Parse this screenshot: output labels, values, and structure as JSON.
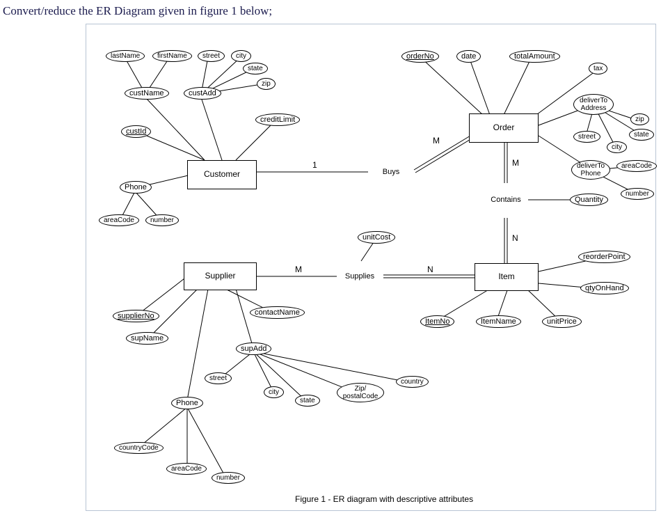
{
  "title": "Convert/reduce the ER Diagram given in figure 1 below;",
  "caption": "Figure 1 - ER diagram with descriptive attributes",
  "entities": {
    "customer": "Customer",
    "order": "Order",
    "supplier": "Supplier",
    "item": "Item"
  },
  "relationships": {
    "buys": "Buys",
    "contains": "Contains",
    "supplies": "Supplies"
  },
  "rel_attrs": {
    "quantity": "Quantity",
    "unitCost": "unitCost"
  },
  "cardinalities": {
    "buys_cust": "1",
    "buys_order": "M",
    "contains_order": "M",
    "contains_item": "N",
    "supplies_supplier": "M",
    "supplies_item": "N"
  },
  "customer_attrs": {
    "custId": "custId",
    "custName": "custName",
    "lastName": "lastName",
    "firstName": "firstName",
    "custAdd": "custAdd",
    "street": "street",
    "city": "city",
    "state": "state",
    "zip": "zip",
    "creditLimit": "creditLimit",
    "phone": "Phone",
    "areaCode": "areaCode",
    "number": "number"
  },
  "order_attrs": {
    "orderNo": "orderNo",
    "date": "date",
    "totalAmount": "totalAmount",
    "tax": "tax",
    "deliverToAddress": "deliverTo\nAddress",
    "da_zip": "zip",
    "da_state": "state",
    "da_street": "street",
    "da_city": "city",
    "deliverToPhone": "deliverTo\nPhone",
    "dp_areaCode": "areaCode",
    "dp_number": "number"
  },
  "item_attrs": {
    "itemNo": "ItemNo",
    "itemName": "ItemName",
    "unitPrice": "unitPrice",
    "qtyOnHand": "qtyOnHand",
    "reorderPoint": "reorderPoint"
  },
  "supplier_attrs": {
    "supplierNo": "supplierNo",
    "supName": "supName",
    "contactName": "contactName",
    "supAdd": "supAdd",
    "sa_street": "street",
    "sa_city": "city",
    "sa_state": "state",
    "sa_zip": "Zip/\npostalCode",
    "sa_country": "country",
    "phone": "Phone",
    "p_countryCode": "countryCode",
    "p_areaCode": "areaCode",
    "p_number": "number"
  }
}
